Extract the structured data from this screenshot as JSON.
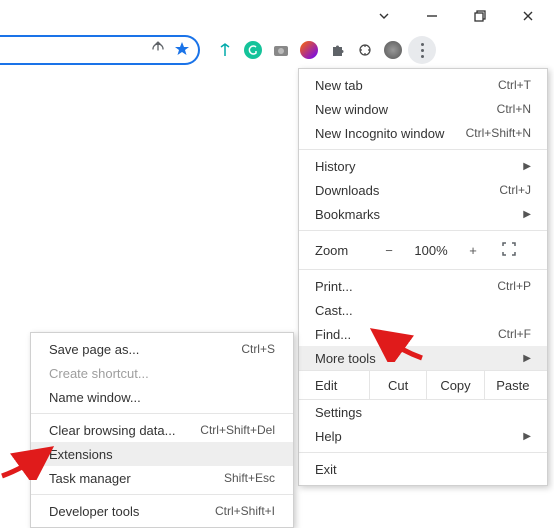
{
  "colors": {
    "accent": "#1a73e8",
    "arrow": "#e01b1b"
  },
  "extensions": {
    "share_icon": "share-icon",
    "star_icon": "star-icon",
    "icons": [
      "ext1",
      "grammarly",
      "camera",
      "firefox-color",
      "puzzle",
      "audio",
      "avatar"
    ]
  },
  "main_menu": {
    "new_tab": {
      "label": "New tab",
      "shortcut": "Ctrl+T"
    },
    "new_window": {
      "label": "New window",
      "shortcut": "Ctrl+N"
    },
    "new_incognito": {
      "label": "New Incognito window",
      "shortcut": "Ctrl+Shift+N"
    },
    "history": {
      "label": "History"
    },
    "downloads": {
      "label": "Downloads",
      "shortcut": "Ctrl+J"
    },
    "bookmarks": {
      "label": "Bookmarks"
    },
    "zoom": {
      "label": "Zoom",
      "minus": "−",
      "value": "100%",
      "plus": "+"
    },
    "print": {
      "label": "Print...",
      "shortcut": "Ctrl+P"
    },
    "cast": {
      "label": "Cast..."
    },
    "find": {
      "label": "Find...",
      "shortcut": "Ctrl+F"
    },
    "more_tools": {
      "label": "More tools"
    },
    "edit": {
      "label": "Edit",
      "cut": "Cut",
      "copy": "Copy",
      "paste": "Paste"
    },
    "settings": {
      "label": "Settings"
    },
    "help": {
      "label": "Help"
    },
    "exit": {
      "label": "Exit"
    }
  },
  "submenu": {
    "save_page": {
      "label": "Save page as...",
      "shortcut": "Ctrl+S"
    },
    "create_shortcut": {
      "label": "Create shortcut..."
    },
    "name_window": {
      "label": "Name window..."
    },
    "clear_data": {
      "label": "Clear browsing data...",
      "shortcut": "Ctrl+Shift+Del"
    },
    "extensions": {
      "label": "Extensions"
    },
    "task_manager": {
      "label": "Task manager",
      "shortcut": "Shift+Esc"
    },
    "dev_tools": {
      "label": "Developer tools",
      "shortcut": "Ctrl+Shift+I"
    }
  }
}
